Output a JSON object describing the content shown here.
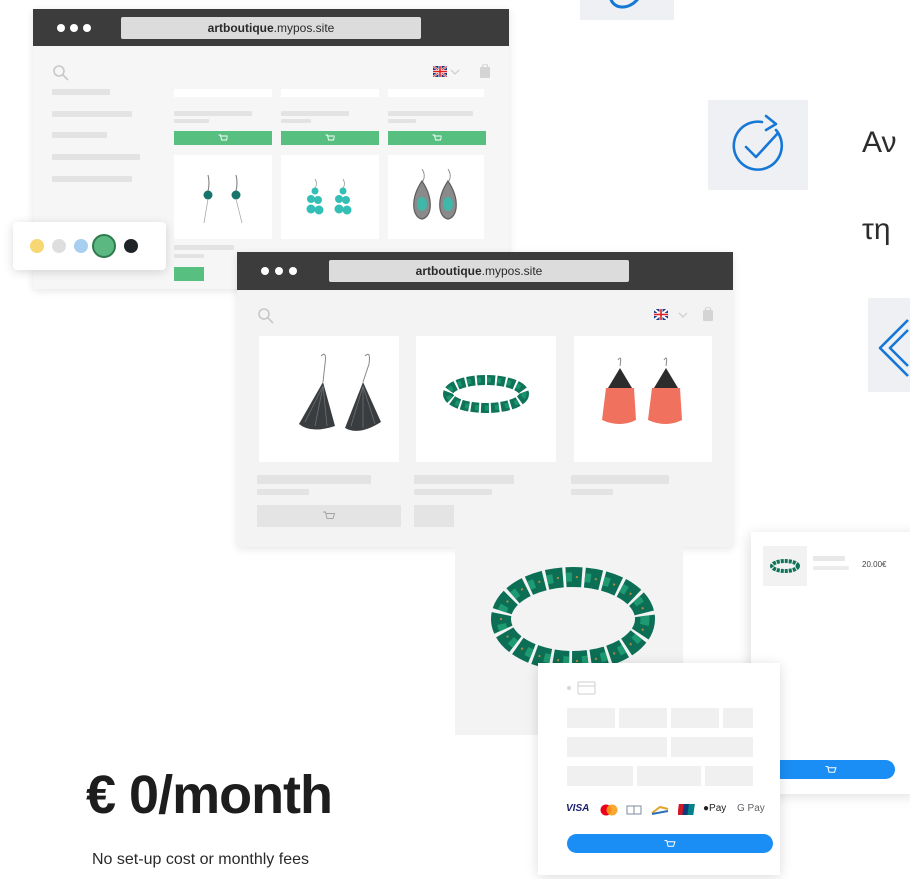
{
  "browser_back": {
    "url_bold": "artboutique",
    "url_rest": ".mypos.site",
    "swatches": [
      "#f7d774",
      "#dedede",
      "#a9cff0",
      "#5ab880",
      "#1e2328"
    ]
  },
  "browser_front": {
    "url_bold": "artboutique",
    "url_rest": ".mypos.site"
  },
  "feature_text": {
    "line1": "Αν",
    "line2": "τη"
  },
  "cart": {
    "price": "20.00€"
  },
  "checkout": {
    "payment_methods": [
      "VISA",
      "Mastercard",
      "Diners",
      "Bank",
      "Card",
      "Apple Pay",
      "G Pay"
    ],
    "apple_pay_label": "Pay",
    "google_pay_label": "G Pay",
    "visa_label": "VISA"
  },
  "pricing": {
    "headline": "€ 0/month",
    "subline": "No set-up cost or monthly fees"
  },
  "colors": {
    "brand_green": "#57bf7f",
    "brand_blue": "#1a8ef5",
    "icon_blue": "#1577d6",
    "titlebar": "#3c3c3c"
  }
}
